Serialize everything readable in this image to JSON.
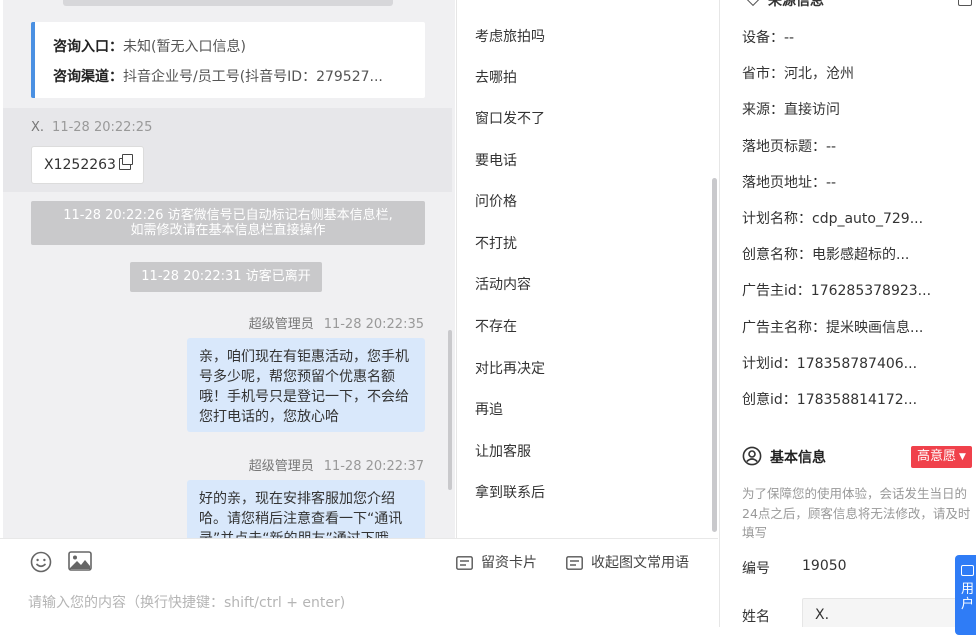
{
  "consult_card": {
    "entry_label": "咨询入口：",
    "entry_value": "未知(暂无入口信息)",
    "channel_label": "咨询渠道：",
    "channel_value": "抖音企业号/员工号(抖音号ID：279527..."
  },
  "visitor_message": {
    "name": "X.",
    "time": "11-28 20:22:25",
    "content": "X1252263"
  },
  "system_notices": [
    {
      "line1": "11-28 20:22:26 访客微信号已自动标记右侧基本信息栏,",
      "line2": "如需修改请在基本信息栏直接操作"
    },
    {
      "line1": "11-28 20:22:31 访客已离开"
    }
  ],
  "agent_messages": [
    {
      "name": "超级管理员",
      "time": "11-28 20:22:35",
      "content": "亲，咱们现在有钜惠活动，您手机号多少呢，帮您预留个优惠名额哦！手机号只是登记一下，不会给您打电话的，您放心哈"
    },
    {
      "name": "超级管理员",
      "time": "11-28 20:22:37",
      "content": "好的亲，现在安排客服加您介绍哈。请您稍后注意查看一下“通讯录”并点击“新的朋友”通过下哦"
    }
  ],
  "composer": {
    "lead_card_label": "留资卡片",
    "fold_label": "收起图文常用语",
    "placeholder": "请输入您的内容（换行快捷键：shift/ctrl + enter)"
  },
  "quick_replies": [
    "考虑旅拍吗",
    "去哪拍",
    "窗口发不了",
    "要电话",
    "问价格",
    "不打扰",
    "活动内容",
    "不存在",
    "对比再决定",
    "再追",
    "让加客服",
    "拿到联系后"
  ],
  "source_info": {
    "header": "来源信息",
    "rows": [
      {
        "label": "设备：",
        "value": "--"
      },
      {
        "label": "省市：",
        "value": "河北，沧州"
      },
      {
        "label": "来源：",
        "value": "直接访问"
      },
      {
        "label": "落地页标题：",
        "value": "--"
      },
      {
        "label": "落地页地址：",
        "value": "--"
      },
      {
        "label": "计划名称：",
        "value": "cdp_auto_729..."
      },
      {
        "label": "创意名称：",
        "value": "电影感超标的..."
      },
      {
        "label": "广告主id：",
        "value": "176285378923..."
      },
      {
        "label": "广告主名称：",
        "value": "提米映画信息..."
      },
      {
        "label": "计划id：",
        "value": "178358787406..."
      },
      {
        "label": "创意id：",
        "value": "178358814172..."
      }
    ]
  },
  "basic_info": {
    "header": "基本信息",
    "intent_badge": "高意愿",
    "notice": "为了保障您的使用体验，会话发生当日的24点之后，顾客信息将无法修改，请及时填写",
    "serial_label": "编号",
    "serial_value": "19050",
    "name_label": "姓名",
    "name_value": "X."
  },
  "float_button": {
    "label": "用户"
  },
  "colors": {
    "accent_blue": "#4a90e2",
    "agent_bubble": "#d9e8fb",
    "intent_red": "#f0414b",
    "float_blue": "#2f7cf6"
  }
}
